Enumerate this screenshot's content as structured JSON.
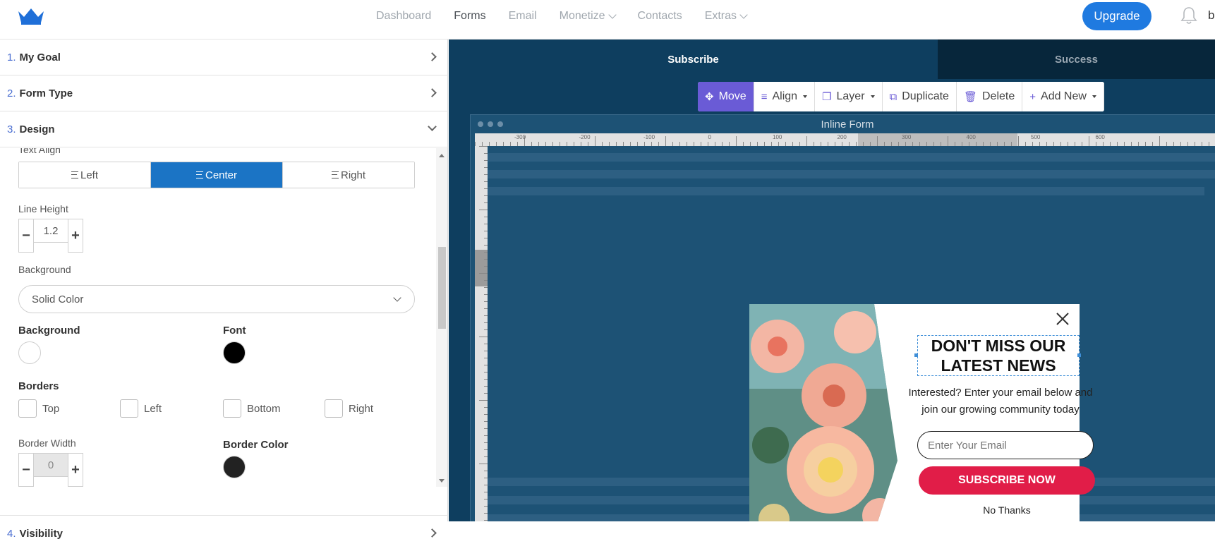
{
  "nav": {
    "items": [
      {
        "label": "Dashboard",
        "active": false,
        "dropdown": false
      },
      {
        "label": "Forms",
        "active": true,
        "dropdown": false
      },
      {
        "label": "Email",
        "active": false,
        "dropdown": false
      },
      {
        "label": "Monetize",
        "active": false,
        "dropdown": true
      },
      {
        "label": "Contacts",
        "active": false,
        "dropdown": false
      },
      {
        "label": "Extras",
        "active": false,
        "dropdown": true
      }
    ],
    "upgrade_label": "Upgrade",
    "user_initial": "b",
    "brand_color": "#1f7ae0"
  },
  "steps": [
    {
      "num": "1.",
      "label": "My Goal"
    },
    {
      "num": "2.",
      "label": "Form Type"
    },
    {
      "num": "3.",
      "label": "Design"
    },
    {
      "num": "4.",
      "label": "Visibility"
    }
  ],
  "design": {
    "cutoff_label": "Text Align",
    "text_align": {
      "options": [
        "Left",
        "Center",
        "Right"
      ],
      "selected": "Center"
    },
    "line_height": {
      "label": "Line Height",
      "value": "1.2"
    },
    "background_select": {
      "label": "Background",
      "value": "Solid Color"
    },
    "background_color": {
      "label": "Background",
      "color": "#ffffff"
    },
    "font_color": {
      "label": "Font",
      "color": "#000000"
    },
    "borders": {
      "label": "Borders",
      "options": [
        "Top",
        "Left",
        "Bottom",
        "Right"
      ]
    },
    "border_width": {
      "label": "Border Width",
      "value": "0"
    },
    "border_color": {
      "label": "Border Color",
      "color": "#222222"
    }
  },
  "canvas": {
    "tabs": {
      "subscribe": "Subscribe",
      "success": "Success"
    },
    "toolbar": {
      "move": "Move",
      "align": "Align",
      "layer": "Layer",
      "duplicate": "Duplicate",
      "delete": "Delete",
      "add_new": "Add New"
    },
    "frame_title": "Inline Form",
    "accent_color": "#6a5bd6",
    "ruler_labels_h": [
      "-300",
      "-200",
      "-100",
      "0",
      "100",
      "200",
      "300",
      "400",
      "500",
      "600"
    ],
    "popup": {
      "headline": "DON'T MISS OUR LATEST NEWS",
      "subtext": "Interested? Enter your email below and join our growing community today",
      "email_placeholder": "Enter Your Email",
      "subscribe_label": "SUBSCRIBE NOW",
      "no_thanks": "No Thanks",
      "button_color": "#e11d48"
    }
  }
}
